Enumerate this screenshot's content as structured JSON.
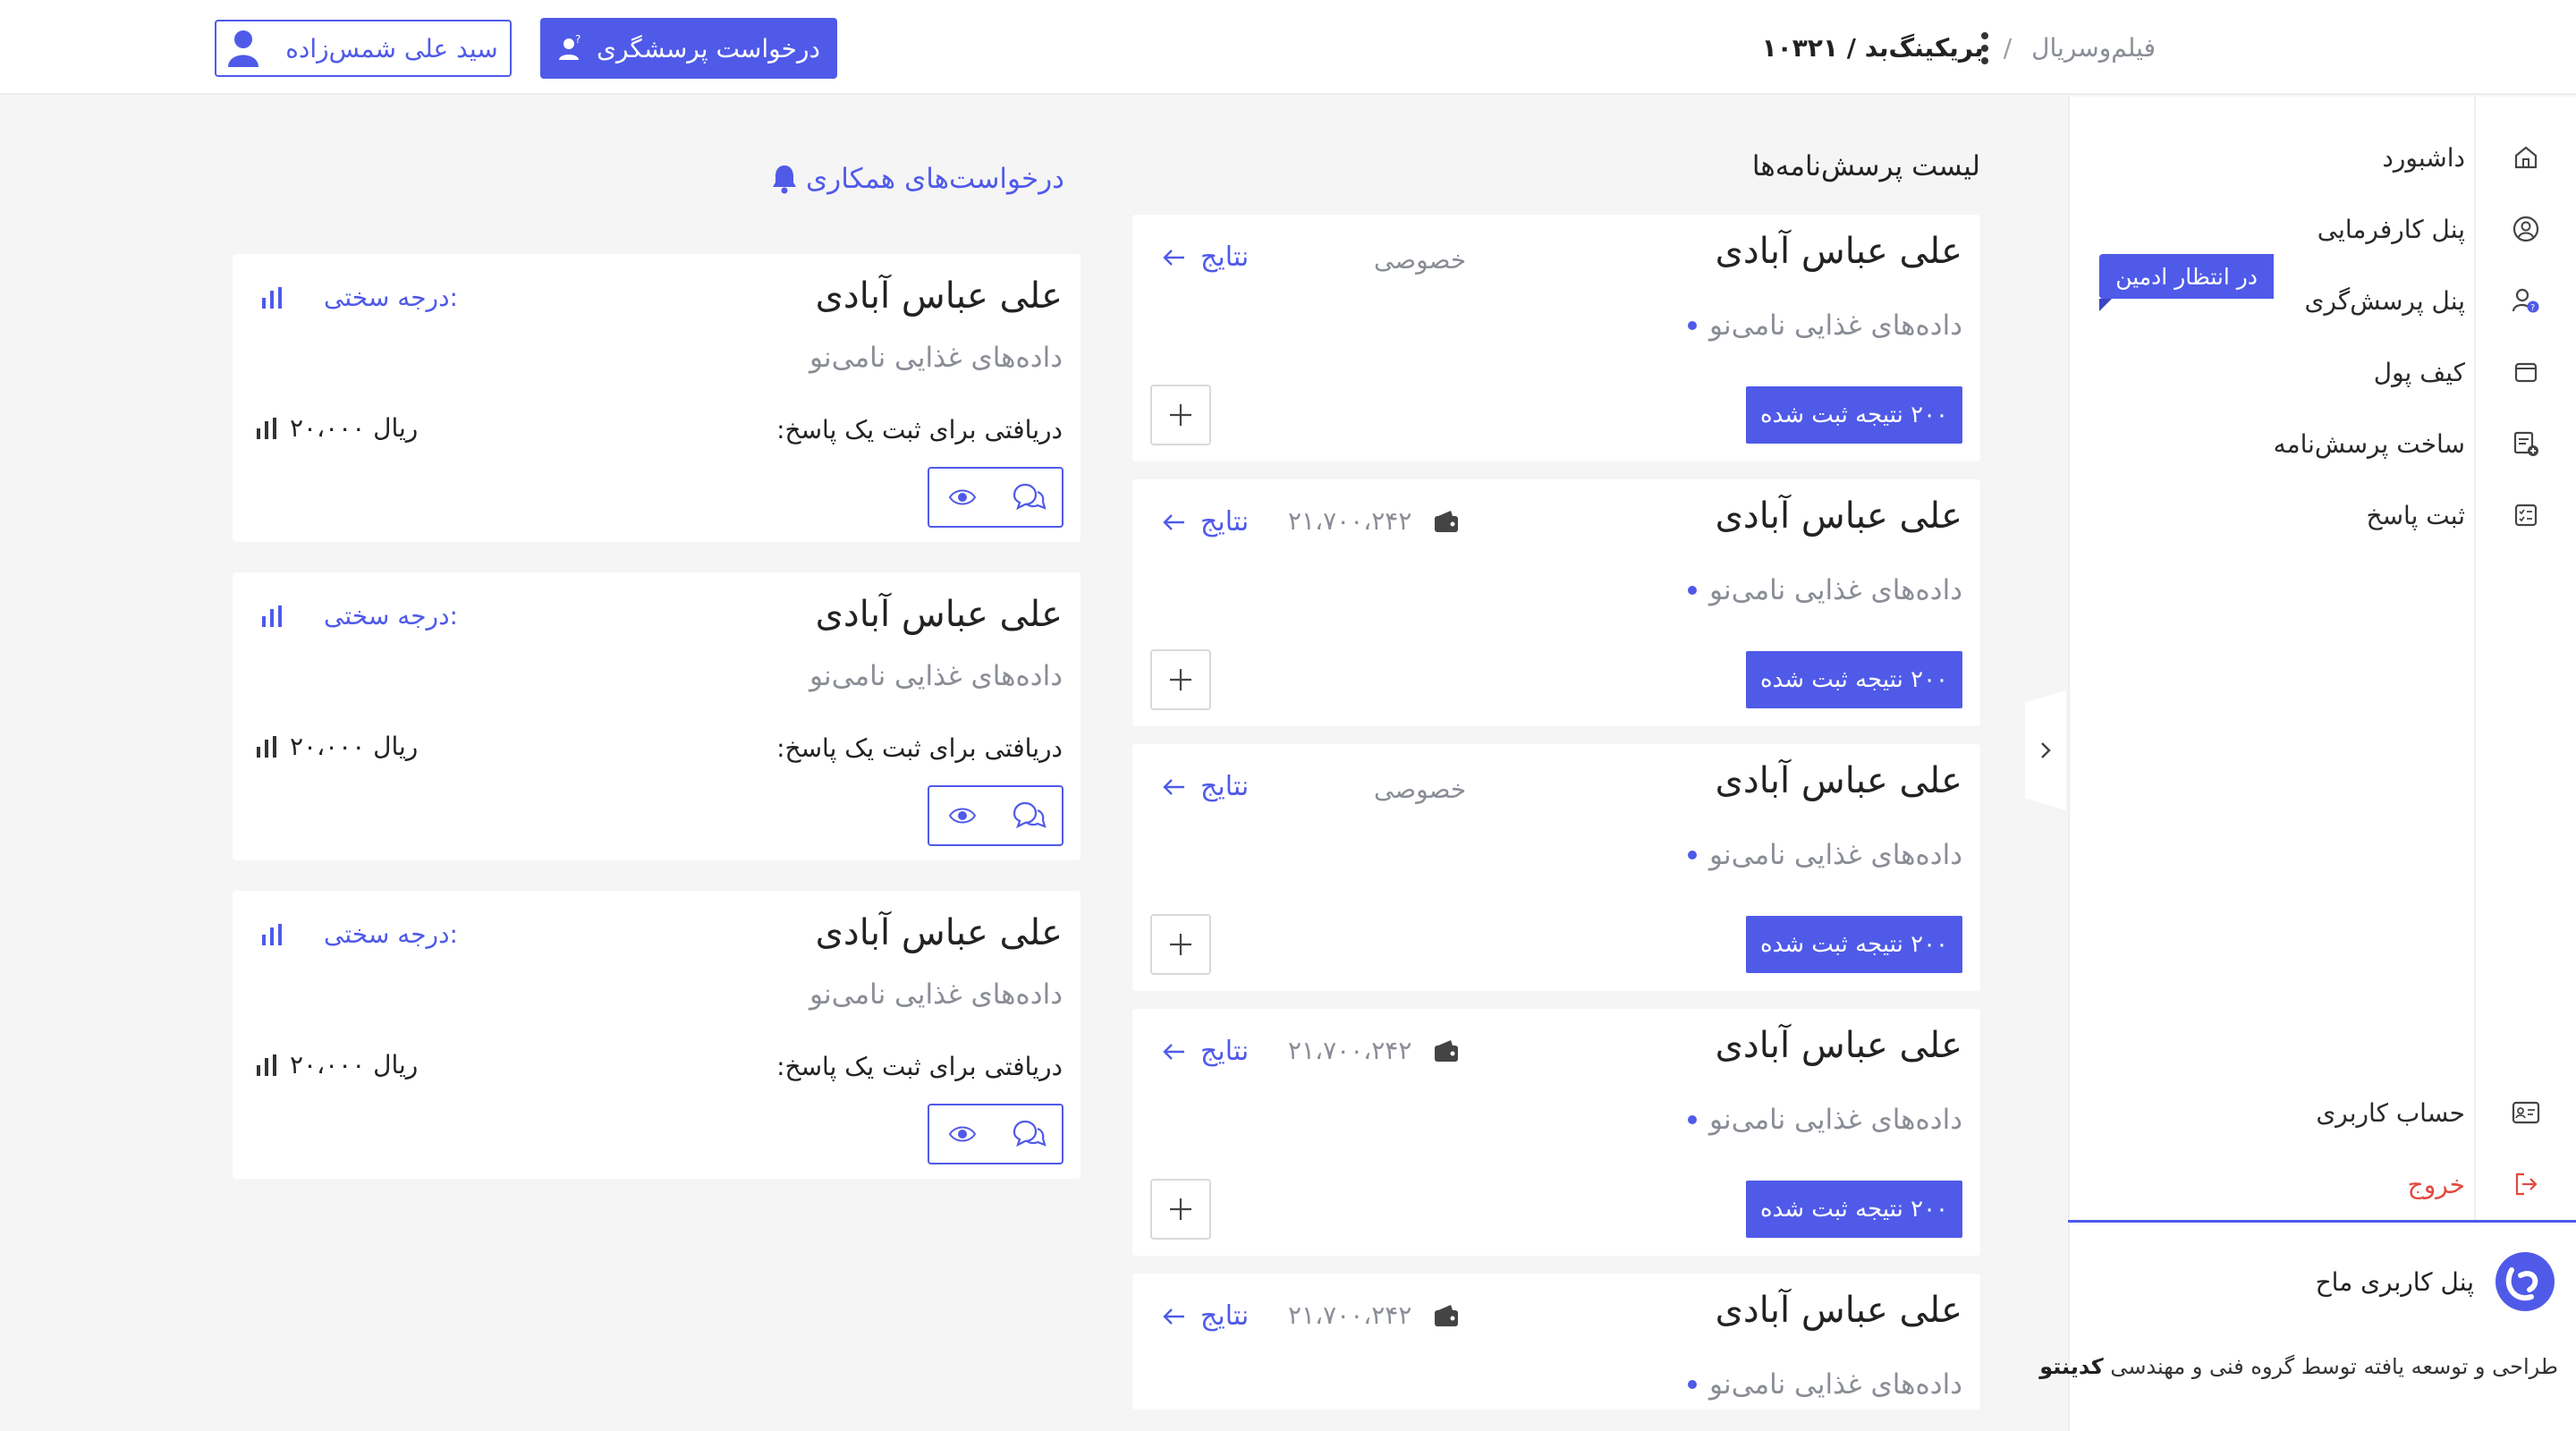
{
  "header": {
    "breadcrumb": {
      "root": "فیلم‌وسریال",
      "separator": "/",
      "current": "بریکینگ‌بد / ۱۰۳۲۱"
    },
    "request_button": "درخواست پرسشگری",
    "user_button": "سید علی شمس‌زاده"
  },
  "sidebar": {
    "items": [
      {
        "label": "داشبورد",
        "icon": "home-icon"
      },
      {
        "label": "پنل کارفرمایی",
        "icon": "user-circle-icon"
      },
      {
        "label": "پنل پرسش‌گری",
        "icon": "user-question-icon"
      },
      {
        "label": "کیف پول",
        "icon": "wallet-icon"
      },
      {
        "label": "ساخت پرسش‌نامه",
        "icon": "document-add-icon"
      },
      {
        "label": "ثبت پاسخ",
        "icon": "checklist-icon"
      }
    ],
    "badge": "در انتظار ادمین",
    "account": "حساب کاربری",
    "logout": "خروج",
    "brand": "پنل کاربری ماح",
    "credit_prefix": "طراحی و توسعه یافته توسط گروه فنی و مهندسی",
    "credit_company": "کدینتو"
  },
  "questionnaires": {
    "title": "لیست پرسش‌نامه‌ها",
    "results_label": "نتایج",
    "items": [
      {
        "title": "علی عباس آبادی",
        "subtitle": "داده‌های غذایی نامی‌نو",
        "button": "۲۰۰ نتیجه ثبت شده",
        "privacy": "خصوصی",
        "price": ""
      },
      {
        "title": "علی عباس آبادی",
        "subtitle": "داده‌های غذایی نامی‌نو",
        "button": "۲۰۰ نتیجه ثبت شده",
        "privacy": "",
        "price": "۲۱،۷۰۰،۲۴۲"
      },
      {
        "title": "علی عباس آبادی",
        "subtitle": "داده‌های غذایی نامی‌نو",
        "button": "۲۰۰ نتیجه ثبت شده",
        "privacy": "خصوصی",
        "price": ""
      },
      {
        "title": "علی عباس آبادی",
        "subtitle": "داده‌های غذایی نامی‌نو",
        "button": "۲۰۰ نتیجه ثبت شده",
        "privacy": "",
        "price": "۲۱،۷۰۰،۲۴۲"
      },
      {
        "title": "علی عباس آبادی",
        "subtitle": "داده‌های غذایی نامی‌نو",
        "button": "",
        "privacy": "",
        "price": "۲۱،۷۰۰،۲۴۲"
      }
    ]
  },
  "collaboration": {
    "title": "درخواست‌های همکاری",
    "difficulty_label": "درجه سختی:",
    "payment_label": "دریافتی برای ثبت یک پاسخ:",
    "items": [
      {
        "title": "علی عباس آبادی",
        "subtitle": "داده‌های غذایی نامی‌نو",
        "amount": "۲۰،۰۰۰ ریال"
      },
      {
        "title": "علی عباس آبادی",
        "subtitle": "داده‌های غذایی نامی‌نو",
        "amount": "۲۰،۰۰۰ ریال"
      },
      {
        "title": "علی عباس آبادی",
        "subtitle": "داده‌های غذایی نامی‌نو",
        "amount": "۲۰،۰۰۰ ریال"
      }
    ]
  },
  "colors": {
    "accent": "#4f5ae8",
    "danger": "#e2483f",
    "background": "#f5f5f6"
  }
}
